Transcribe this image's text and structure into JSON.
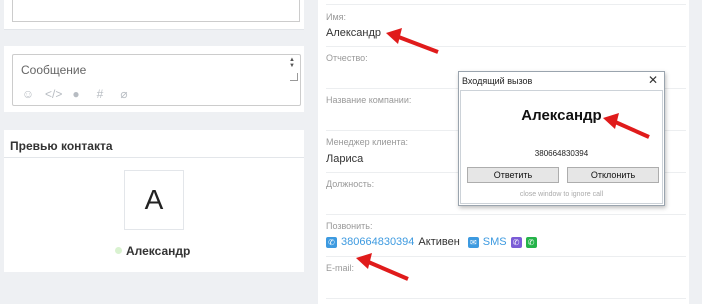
{
  "message": {
    "placeholder": "Сообщение",
    "icons": [
      "smile-icon",
      "code-icon",
      "users-icon",
      "hash-icon",
      "paperclip-icon"
    ]
  },
  "preview": {
    "title": "Превью контакта",
    "avatar_letter": "А",
    "name": "Александр"
  },
  "fields": {
    "name_label": "Имя:",
    "name_value": "Александр",
    "patronymic_label": "Отчество:",
    "company_label": "Название компании:",
    "manager_label": "Менеджер клиента:",
    "manager_value": "Лариса",
    "position_label": "Должность:",
    "call_label": "Позвонить:",
    "phone": "380664830394",
    "phone_status": "Активен",
    "sms_label": "SMS",
    "email_label": "E-mail:"
  },
  "popup": {
    "title": "Входящий вызов",
    "caller_name": "Александр",
    "caller_phone": "380664830394",
    "answer_label": "Ответить",
    "decline_label": "Отклонить",
    "hint": "close window to ignore call"
  },
  "colors": {
    "accent": "#3d9ae0",
    "viber": "#7b5cd6",
    "whatsapp": "#25b34a",
    "arrow": "#e01b1b"
  }
}
